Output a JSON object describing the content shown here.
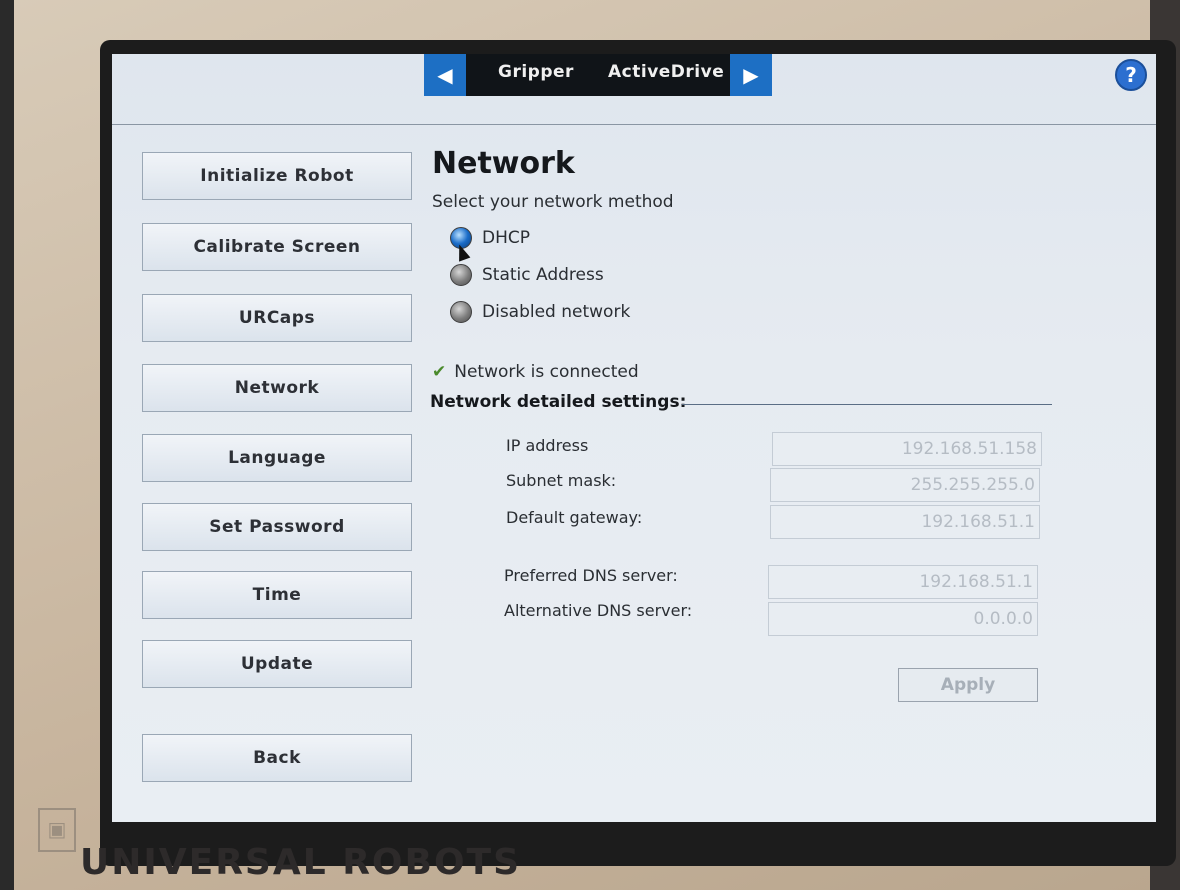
{
  "header": {
    "tabs": [
      "Gripper",
      "ActiveDrive"
    ],
    "prev_arrow": "◀",
    "next_arrow": "▶",
    "help_label": "?"
  },
  "sidebar": {
    "items": [
      {
        "label": "Initialize Robot"
      },
      {
        "label": "Calibrate Screen"
      },
      {
        "label": "URCaps"
      },
      {
        "label": "Network"
      },
      {
        "label": "Language"
      },
      {
        "label": "Set Password"
      },
      {
        "label": "Time"
      },
      {
        "label": "Update"
      }
    ],
    "back_label": "Back"
  },
  "network": {
    "title": "Network",
    "subtitle": "Select your network method",
    "methods": [
      {
        "label": "DHCP",
        "selected": true
      },
      {
        "label": "Static Address",
        "selected": false
      },
      {
        "label": "Disabled network",
        "selected": false
      }
    ],
    "status": "Network is connected",
    "detail_heading": "Network detailed settings:",
    "fields": {
      "ip": {
        "label": "IP address",
        "value": "192.168.51.158"
      },
      "subnet": {
        "label": "Subnet mask:",
        "value": "255.255.255.0"
      },
      "gateway": {
        "label": "Default gateway:",
        "value": "192.168.51.1"
      },
      "dns1": {
        "label": "Preferred DNS server:",
        "value": "192.168.51.1"
      },
      "dns2": {
        "label": "Alternative DNS server:",
        "value": "0.0.0.0"
      }
    },
    "apply_label": "Apply"
  },
  "brand": "UNIVERSAL ROBOTS",
  "colors": {
    "accent": "#1d6fc4",
    "tab_bg": "#101418",
    "status_ok": "#4a8a2c"
  }
}
